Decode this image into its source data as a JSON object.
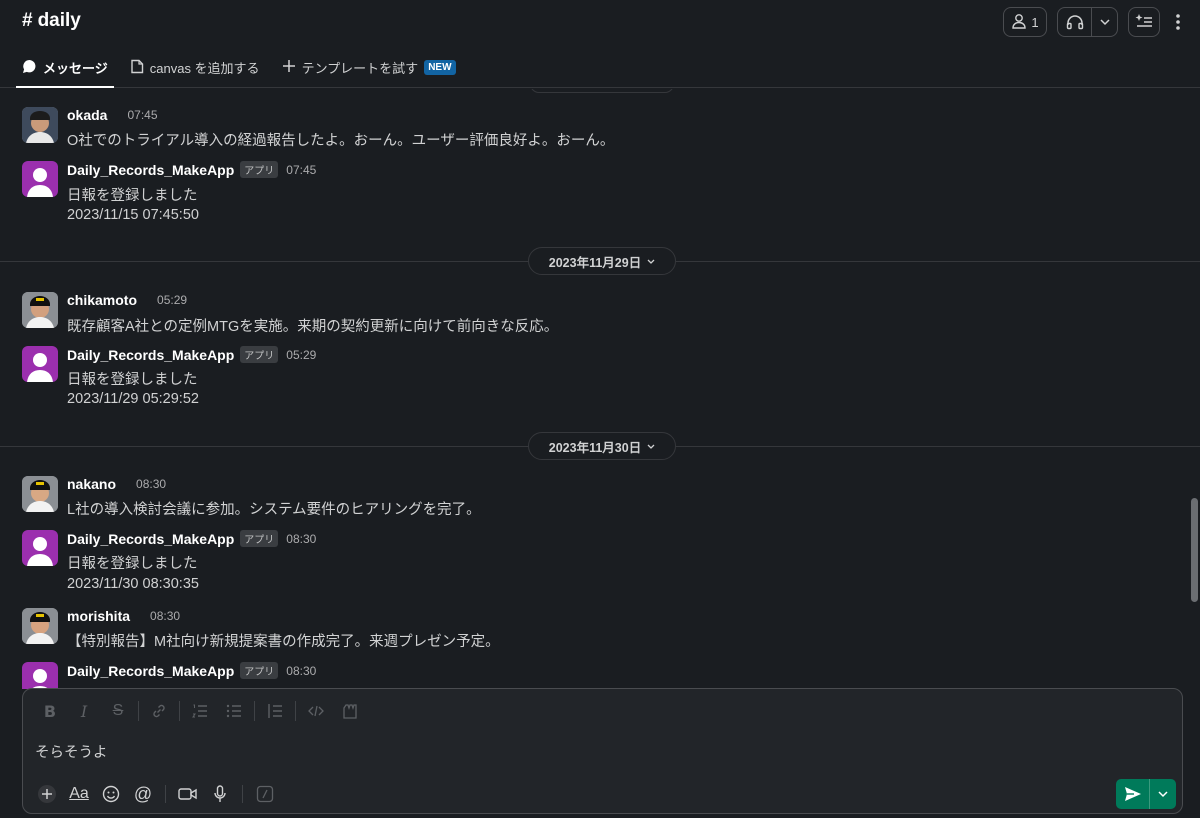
{
  "header": {
    "channel_name": "daily",
    "member_count": "1"
  },
  "tabs": [
    {
      "label": "メッセージ"
    },
    {
      "label": "canvas を追加する"
    },
    {
      "label": "テンプレートを試す",
      "badge": "NEW"
    }
  ],
  "app_badge": "アプリ",
  "dates": {
    "d1": "2023年11月29日",
    "d2": "2023年11月30日"
  },
  "messages": [
    {
      "user": "okada",
      "time": "07:45",
      "text": "O社でのトライアル導入の経過報告したよ。おーん。ユーザー評価良好よ。おーん。"
    },
    {
      "user": "Daily_Records_MakeApp",
      "time": "07:45",
      "text": "日報を登録しました",
      "text2": "2023/11/15 07:45:50"
    },
    {
      "user": "chikamoto",
      "time": "05:29",
      "text": "既存顧客A社との定例MTGを実施。来期の契約更新に向けて前向きな反応。"
    },
    {
      "user": "Daily_Records_MakeApp",
      "time": "05:29",
      "text": "日報を登録しました",
      "text2": "2023/11/29 05:29:52"
    },
    {
      "user": "nakano",
      "time": "08:30",
      "text": "L社の導入検討会議に参加。システム要件のヒアリングを完了。"
    },
    {
      "user": "Daily_Records_MakeApp",
      "time": "08:30",
      "text": "日報を登録しました",
      "text2": "2023/11/30 08:30:35"
    },
    {
      "user": "morishita",
      "time": "08:30",
      "text": "【特別報告】M社向け新規提案書の作成完了。来週プレゼン予定。"
    },
    {
      "user": "Daily_Records_MakeApp",
      "time": "08:30"
    }
  ],
  "composer": {
    "text": "そらそうよ"
  },
  "colors": {
    "background": "#1a1d21",
    "app_avatar": "#9b2fae",
    "send_button": "#007a5a",
    "new_badge": "#1264a3"
  }
}
